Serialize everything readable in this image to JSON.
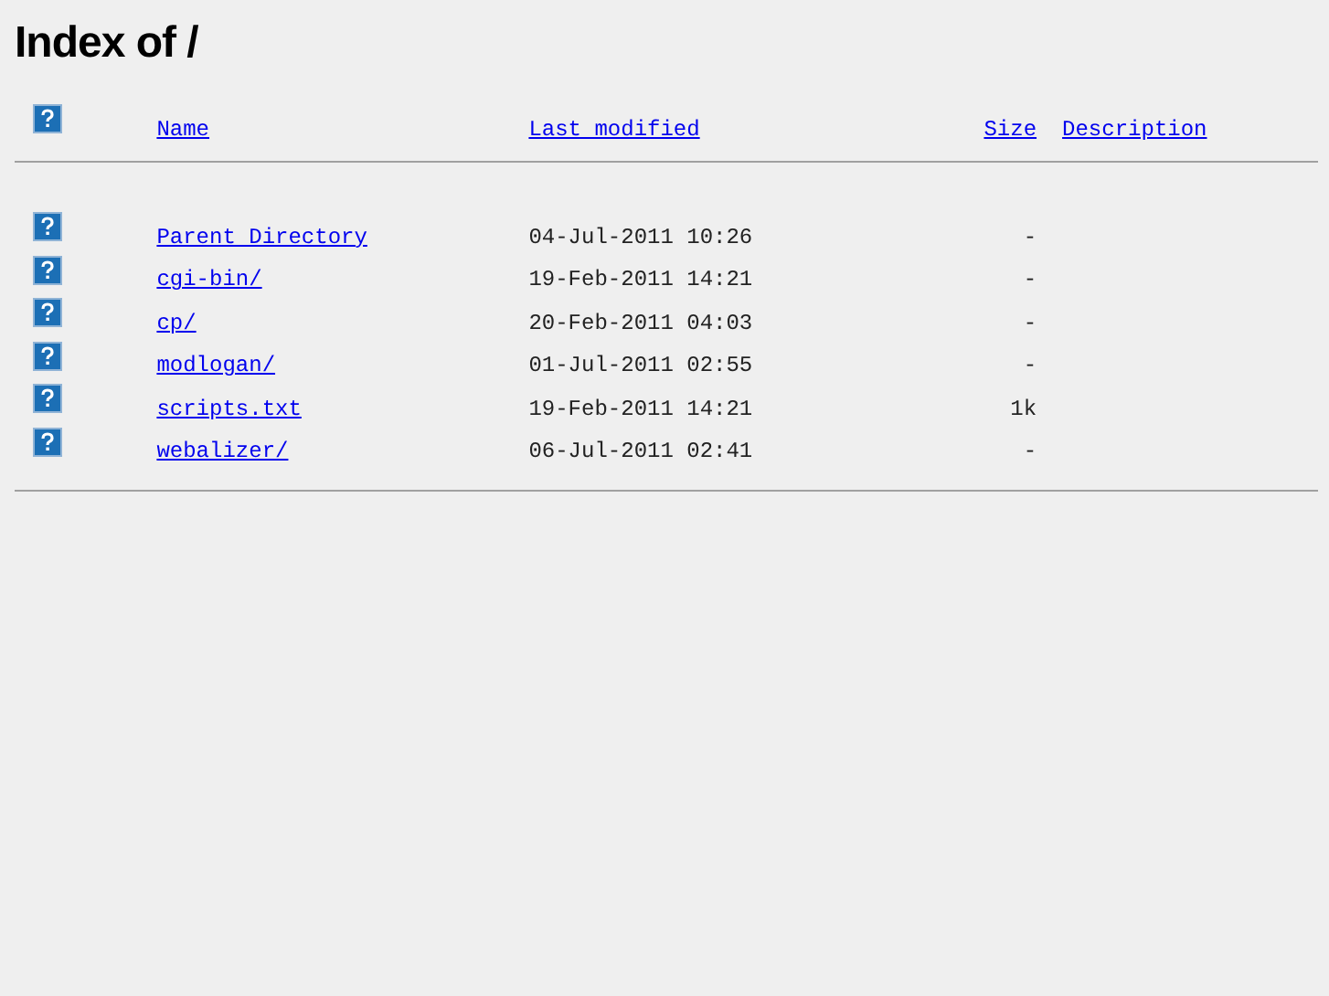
{
  "title": "Index of /",
  "columns": [
    "Name",
    "Last modified",
    "Size",
    "Description"
  ],
  "rows": [
    {
      "name": "Parent Directory",
      "last_modified": "04-Jul-2011 10:26",
      "size": "-"
    },
    {
      "name": "cgi-bin/",
      "last_modified": "19-Feb-2011 14:21",
      "size": "-"
    },
    {
      "name": "cp/",
      "last_modified": "20-Feb-2011 04:03",
      "size": "-"
    },
    {
      "name": "modlogan/",
      "last_modified": "01-Jul-2011 02:55",
      "size": "-"
    },
    {
      "name": "scripts.txt",
      "last_modified": "19-Feb-2011 14:21",
      "size": "1k"
    },
    {
      "name": "webalizer/",
      "last_modified": "06-Jul-2011 02:41",
      "size": "-"
    }
  ]
}
